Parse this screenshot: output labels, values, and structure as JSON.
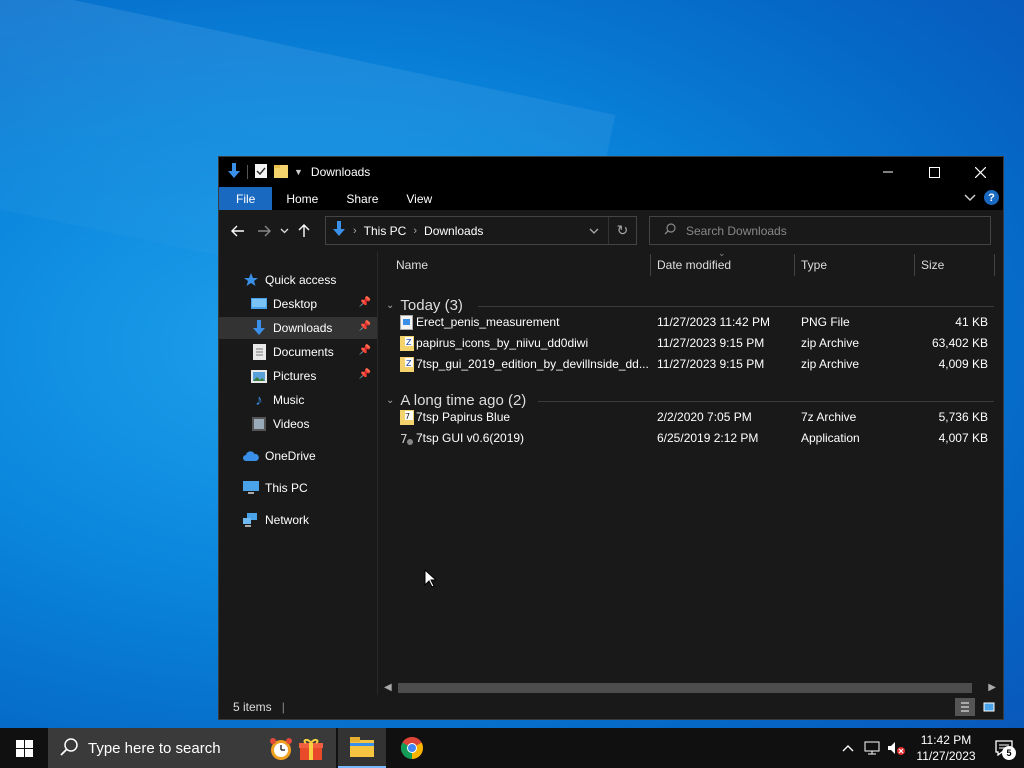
{
  "window": {
    "title": "Downloads",
    "ribbon_tabs": [
      "File",
      "Home",
      "Share",
      "View"
    ],
    "help_label": "?"
  },
  "address": {
    "segments": [
      "This PC",
      "Downloads"
    ]
  },
  "search": {
    "placeholder": "Search Downloads"
  },
  "sidebar": {
    "items": [
      {
        "label": "Quick access",
        "icon": "star-icon"
      },
      {
        "label": "Desktop",
        "icon": "desktop-folder-icon",
        "pinned": true
      },
      {
        "label": "Downloads",
        "icon": "downloads-folder-icon",
        "pinned": true,
        "selected": true
      },
      {
        "label": "Documents",
        "icon": "documents-folder-icon",
        "pinned": true
      },
      {
        "label": "Pictures",
        "icon": "pictures-folder-icon",
        "pinned": true
      },
      {
        "label": "Music",
        "icon": "music-folder-icon"
      },
      {
        "label": "Videos",
        "icon": "videos-folder-icon"
      },
      {
        "label": "OneDrive",
        "icon": "onedrive-icon"
      },
      {
        "label": "This PC",
        "icon": "this-pc-icon"
      },
      {
        "label": "Network",
        "icon": "network-icon"
      }
    ]
  },
  "columns": [
    "Name",
    "Date modified",
    "Type",
    "Size"
  ],
  "groups": [
    {
      "label": "Today (3)",
      "files": [
        {
          "name": "Erect_penis_measurement",
          "date": "11/27/2023 11:42 PM",
          "type": "PNG File",
          "size": "41 KB",
          "icon": "png-file-icon"
        },
        {
          "name": "papirus_icons_by_niivu_dd0diwi",
          "date": "11/27/2023 9:15 PM",
          "type": "zip Archive",
          "size": "63,402 KB",
          "icon": "zip-archive-icon"
        },
        {
          "name": "7tsp_gui_2019_edition_by_devillnside_dd...",
          "date": "11/27/2023 9:15 PM",
          "type": "zip Archive",
          "size": "4,009 KB",
          "icon": "zip-archive-icon"
        }
      ]
    },
    {
      "label": "A long time ago (2)",
      "files": [
        {
          "name": "7tsp Papirus Blue",
          "date": "2/2/2020 7:05 PM",
          "type": "7z Archive",
          "size": "5,736 KB",
          "icon": "7z-archive-icon"
        },
        {
          "name": "7tsp GUI v0.6(2019)",
          "date": "6/25/2019 2:12 PM",
          "type": "Application",
          "size": "4,007 KB",
          "icon": "application-icon"
        }
      ]
    }
  ],
  "status": {
    "item_count": "5 items"
  },
  "taskbar": {
    "search_placeholder": "Type here to search",
    "time": "11:42 PM",
    "date": "11/27/2023",
    "notification_count": "5"
  }
}
